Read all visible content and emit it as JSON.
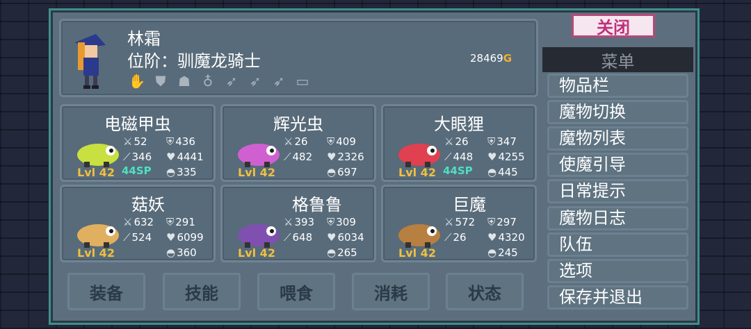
{
  "hero": {
    "name": "林霜",
    "rank": "位阶：驯魔龙骑士",
    "gold_amount": "28469",
    "gold_symbol": "G",
    "equip_icons": [
      "glove-icon",
      "armor-icon",
      "helmet-icon",
      "amulet-icon",
      "feather-icon",
      "feather-icon",
      "feather-icon",
      "book-icon"
    ]
  },
  "monsters": [
    {
      "name": "电磁甲虫",
      "atk": "52",
      "def": "436",
      "mag": "346",
      "hp": "4441",
      "food": "335",
      "level": "Lvl 42",
      "sp": "44SP",
      "color": "#c8e040"
    },
    {
      "name": "辉光虫",
      "atk": "26",
      "def": "409",
      "mag": "482",
      "hp": "2326",
      "food": "697",
      "level": "Lvl 42",
      "sp": "",
      "color": "#d060d0"
    },
    {
      "name": "大眼狸",
      "atk": "26",
      "def": "347",
      "mag": "448",
      "hp": "4255",
      "food": "445",
      "level": "Lvl 42",
      "sp": "44SP",
      "color": "#e04050"
    },
    {
      "name": "菇妖",
      "atk": "632",
      "def": "291",
      "mag": "524",
      "hp": "6099",
      "food": "360",
      "level": "Lvl 42",
      "sp": "",
      "color": "#e0b060"
    },
    {
      "name": "格鲁鲁",
      "atk": "393",
      "def": "309",
      "mag": "648",
      "hp": "6034",
      "food": "265",
      "level": "Lvl 42",
      "sp": "",
      "color": "#8050b0"
    },
    {
      "name": "巨魔",
      "atk": "572",
      "def": "297",
      "mag": "26",
      "hp": "4320",
      "food": "245",
      "level": "Lvl 42",
      "sp": "",
      "color": "#b88040"
    }
  ],
  "tabs": [
    "装备",
    "技能",
    "喂食",
    "消耗",
    "状态"
  ],
  "menu": {
    "close_label": "关闭",
    "title": "菜单",
    "items": [
      "物品栏",
      "魔物切换",
      "魔物列表",
      "使魔引导",
      "日常提示",
      "魔物日志",
      "队伍",
      "选项",
      "保存并退出"
    ]
  },
  "colors": {
    "accent_gold": "#f0c040",
    "accent_sp": "#4ee0c0",
    "close_border": "#b34a78"
  }
}
